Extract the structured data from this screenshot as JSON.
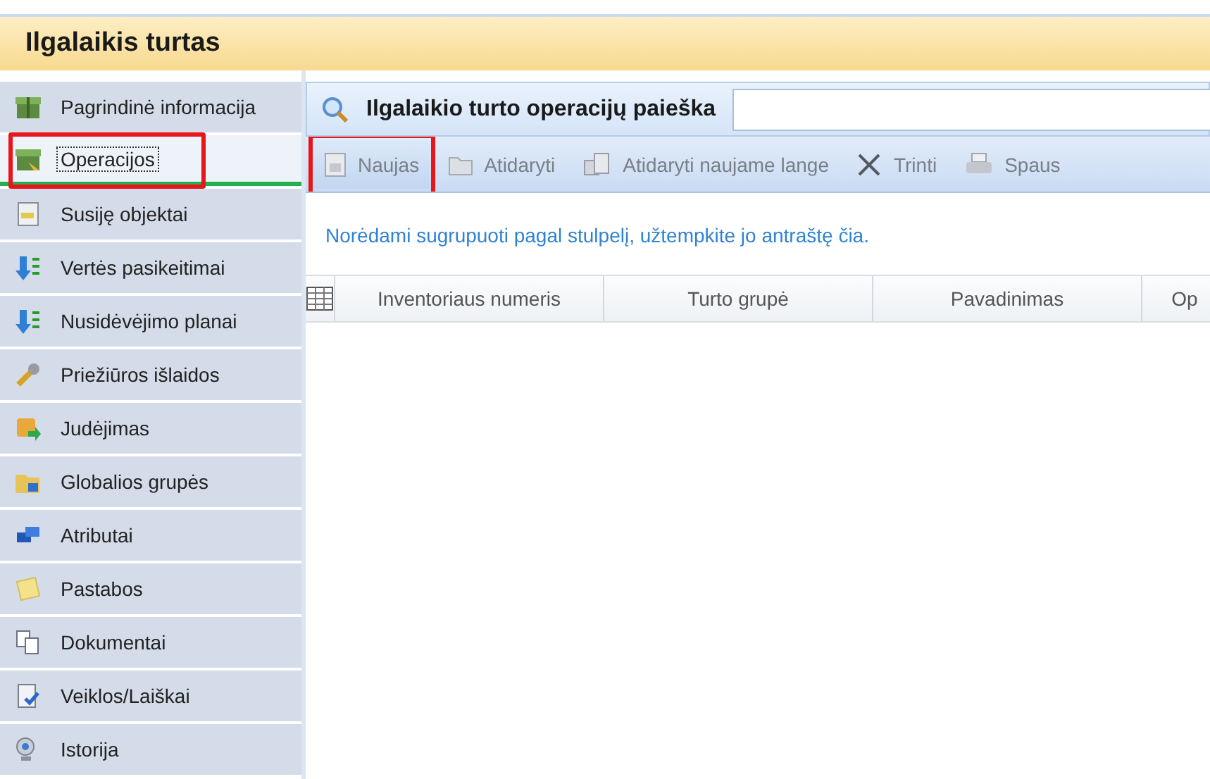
{
  "window": {
    "title": "Ilgalaikis turtas"
  },
  "sidebar": {
    "items": [
      {
        "label": "Pagrindinė informacija",
        "selected": false,
        "highlighted": false
      },
      {
        "label": "Operacijos",
        "selected": true,
        "highlighted": true
      },
      {
        "label": "Susiję objektai",
        "selected": false,
        "highlighted": false
      },
      {
        "label": "Vertės pasikeitimai",
        "selected": false,
        "highlighted": false
      },
      {
        "label": "Nusidėvėjimo planai",
        "selected": false,
        "highlighted": false
      },
      {
        "label": "Priežiūros išlaidos",
        "selected": false,
        "highlighted": false
      },
      {
        "label": "Judėjimas",
        "selected": false,
        "highlighted": false
      },
      {
        "label": "Globalios grupės",
        "selected": false,
        "highlighted": false
      },
      {
        "label": "Atributai",
        "selected": false,
        "highlighted": false
      },
      {
        "label": "Pastabos",
        "selected": false,
        "highlighted": false
      },
      {
        "label": "Dokumentai",
        "selected": false,
        "highlighted": false
      },
      {
        "label": "Veiklos/Laiškai",
        "selected": false,
        "highlighted": false
      },
      {
        "label": "Istorija",
        "selected": false,
        "highlighted": false
      }
    ]
  },
  "search": {
    "title": "Ilgalaikio turto operacijų paieška"
  },
  "toolbar": {
    "buttons": [
      {
        "kind": "new",
        "label": "Naujas",
        "highlighted": true
      },
      {
        "kind": "open",
        "label": "Atidaryti",
        "highlighted": false
      },
      {
        "kind": "open_window",
        "label": "Atidaryti naujame lange",
        "highlighted": false
      },
      {
        "kind": "delete",
        "label": "Trinti",
        "highlighted": false
      },
      {
        "kind": "print",
        "label": "Spaus",
        "highlighted": false
      }
    ]
  },
  "group_hint": "Norėdami sugrupuoti pagal stulpelį, užtempkite jo antraštę čia.",
  "table": {
    "columns": [
      "Inventoriaus numeris",
      "Turto grupė",
      "Pavadinimas",
      "Op"
    ]
  }
}
